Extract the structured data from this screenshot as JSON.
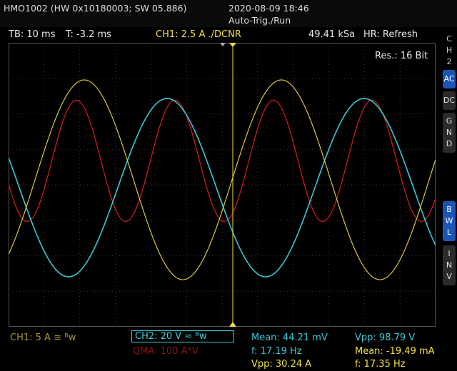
{
  "header": {
    "model": "HMO1002 (HW 0x10180003; SW 05.886)",
    "date": "2020-08-09 18:46",
    "mode": "Auto-Trig./Run"
  },
  "status": {
    "timebase": "TB: 10 ms",
    "trigger_time": "T: -3.2 ms",
    "ch1_info": "CH1: 2.5 A ./DCNR",
    "sample_rate": "49.41 kSa",
    "hr_mode": "HR: Refresh"
  },
  "plot": {
    "resolution": "Res.: 16 Bit",
    "colors": {
      "ch1": "#e8d840",
      "ch2": "#38c8d8",
      "math": "#cc1a1a",
      "grid": "#3a3a3a"
    }
  },
  "sidebar": {
    "ch_label": [
      "C",
      "H",
      "2"
    ],
    "ac": "AC",
    "dc": "DC",
    "gnd": [
      "G",
      "N",
      "D"
    ],
    "bwl": [
      "B",
      "W",
      "L"
    ],
    "inv": [
      "I",
      "N",
      "V"
    ]
  },
  "footer": {
    "ch1": "CH1: 5 A ≅ ᴮw",
    "ch2": "CH2: 20 V ≈ ᴮw",
    "qma": "QMA: 100 A*V",
    "mean1": "Mean: 44.21 mV",
    "freq1": "f: 17.19 Hz",
    "vpp1": "Vpp: 30.24 A",
    "vpp2": "Vpp: 98.79 V",
    "mean2": "Mean: -19.49 mA",
    "freq2": "f: 17.35 Hz"
  }
}
